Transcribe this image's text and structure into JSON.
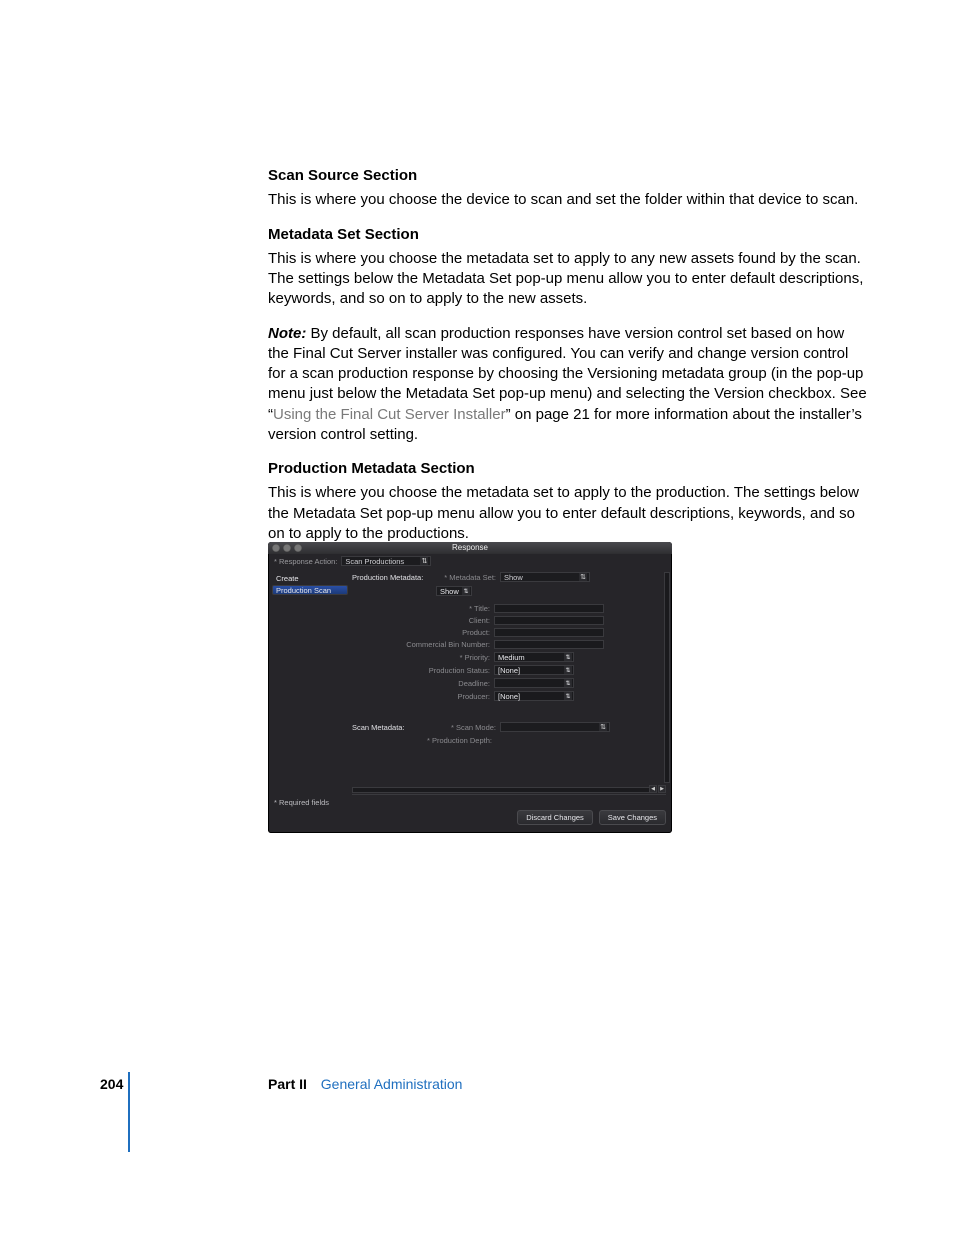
{
  "sections": {
    "scanSource": {
      "heading": "Scan Source Section",
      "body1": "This is where you choose the device to scan and set the folder within that device to scan."
    },
    "metadataSet": {
      "heading": "Metadata Set Section",
      "body1": "This is where you choose the metadata set to apply to any new assets found by the scan. The settings below the Metadata Set pop-up menu allow you to enter default descriptions, keywords, and so on to apply to the new assets."
    },
    "note": {
      "label": "Note:",
      "text1": "  By default, all scan production responses have version control set based on how the Final Cut Server installer was configured. You can verify and change version control for a scan production response by choosing the Versioning metadata group (in the pop-up menu just below the Metadata Set pop-up menu) and selecting the Version checkbox. See “",
      "xref": "Using the Final Cut Server Installer",
      "text2": "” on page 21 for more information about the installer’s version control setting."
    },
    "prodMeta": {
      "heading": "Production Metadata Section",
      "body1": "This is where you choose the metadata set to apply to the production. The settings below the Metadata Set pop-up menu allow you to enter default descriptions, keywords, and so on to apply to the productions."
    }
  },
  "footer": {
    "page": "204",
    "part": "Part II",
    "title": "General Administration"
  },
  "shot": {
    "windowTitle": "Response",
    "responseActionLabel": "* Response Action:",
    "responseActionValue": "Scan Productions",
    "sidebar": {
      "create": "Create",
      "selected": "Production Scan"
    },
    "prodMetaLabel": "Production Metadata:",
    "metadataSetLabel": "* Metadata Set:",
    "metadataSetValue": "Show",
    "subgroupValue": "Show",
    "fields": {
      "title": "* Title:",
      "client": "Client:",
      "product": "Product:",
      "cbn": "Commercial Bin Number:",
      "priority": "* Priority:",
      "priorityVal": "Medium",
      "prodStatus": "Production Status:",
      "prodStatusVal": "[None]",
      "deadline": "Deadline:",
      "producer": "Producer:",
      "producerVal": "[None]"
    },
    "scanMetaLabel": "Scan Metadata:",
    "scanModeLabel": "* Scan Mode:",
    "prodDepthLabel": "* Production Depth:",
    "required": "* Required fields",
    "discard": "Discard Changes",
    "save": "Save Changes"
  }
}
